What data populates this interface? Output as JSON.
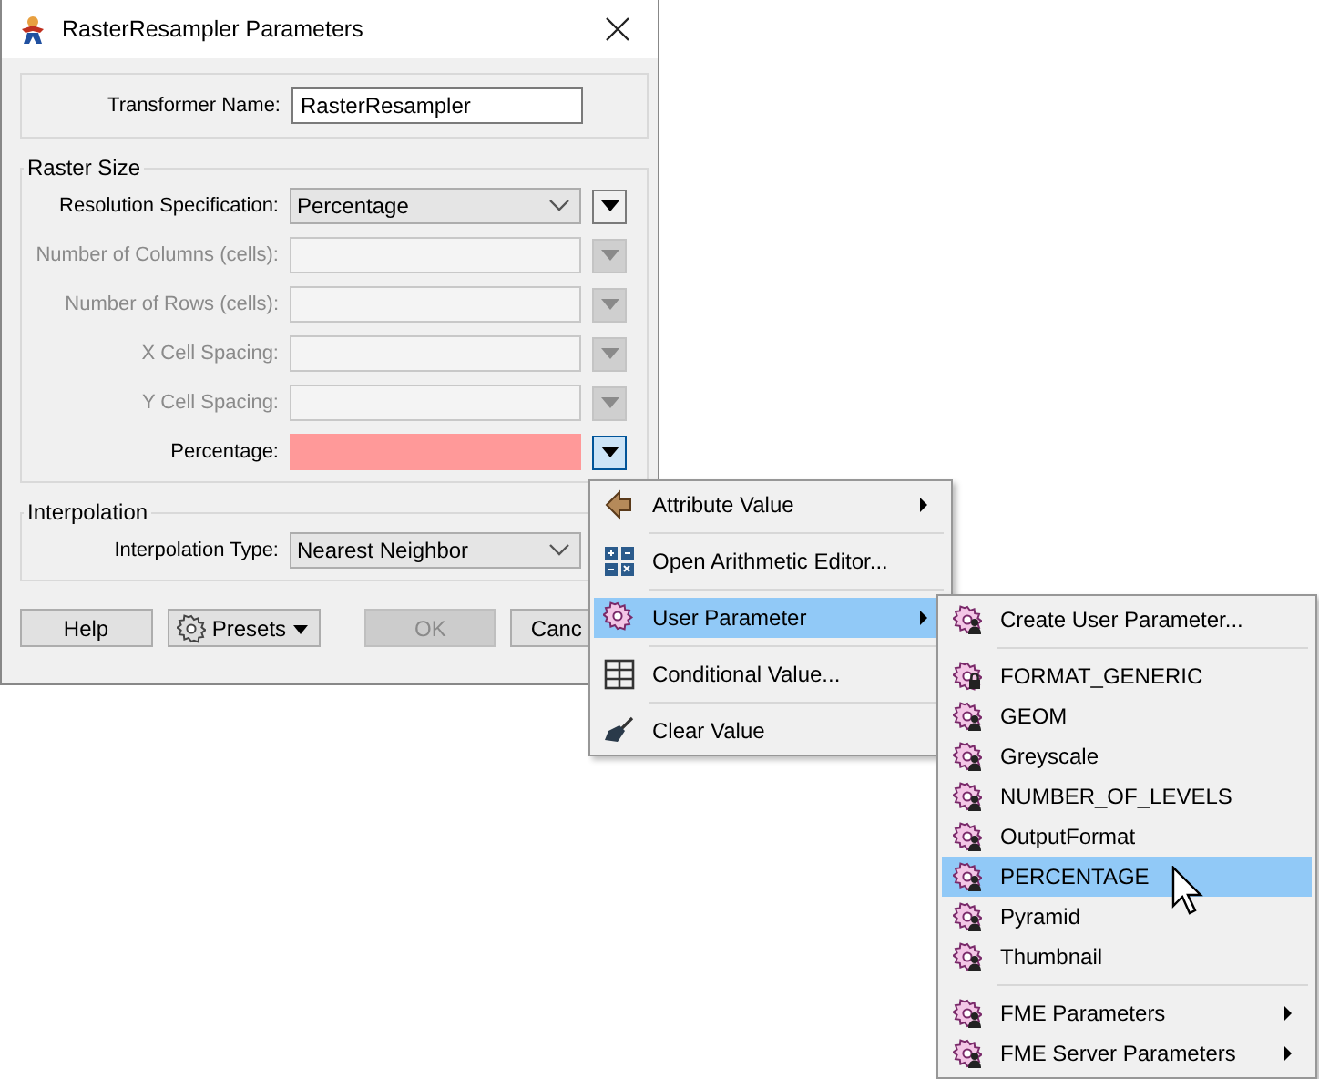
{
  "window": {
    "title": "RasterResampler Parameters"
  },
  "transformer_name": {
    "label": "Transformer Name:",
    "value": "RasterResampler"
  },
  "raster_size": {
    "title": "Raster Size",
    "rows": [
      {
        "label": "Resolution Specification:",
        "kind": "select",
        "value": "Percentage",
        "disabled": false,
        "menu_open": false
      },
      {
        "label": "Number of Columns (cells):",
        "kind": "text",
        "disabled": true,
        "invalid": false,
        "menu_open": false
      },
      {
        "label": "Number of Rows (cells):",
        "kind": "text",
        "disabled": true,
        "invalid": false,
        "menu_open": false
      },
      {
        "label": "X Cell Spacing:",
        "kind": "text",
        "disabled": true,
        "invalid": false,
        "menu_open": false
      },
      {
        "label": "Y Cell Spacing:",
        "kind": "text",
        "disabled": true,
        "invalid": false,
        "menu_open": false
      },
      {
        "label": "Percentage:",
        "kind": "text",
        "disabled": false,
        "invalid": true,
        "menu_open": true
      }
    ]
  },
  "interpolation": {
    "title": "Interpolation",
    "rows": [
      {
        "label": "Interpolation Type:",
        "kind": "select",
        "value": "Nearest Neighbor",
        "disabled": false
      }
    ]
  },
  "buttons": [
    {
      "label": "Help",
      "kind": "plain",
      "disabled": false
    },
    {
      "label": "Presets",
      "kind": "presets",
      "disabled": false
    },
    {
      "label": "OK",
      "kind": "plain",
      "disabled": true
    },
    {
      "label": "Canc",
      "kind": "plain",
      "disabled": false
    }
  ],
  "context_menu": {
    "items": [
      {
        "label": "Attribute Value",
        "has_submenu": true,
        "selected": false
      },
      {
        "label": "Open Arithmetic Editor...",
        "has_submenu": false,
        "selected": false
      },
      {
        "label": "User Parameter",
        "has_submenu": true,
        "selected": true
      },
      {
        "label": "Conditional Value...",
        "has_submenu": false,
        "selected": false
      },
      {
        "label": "Clear Value",
        "has_submenu": false,
        "selected": false
      }
    ]
  },
  "user_parameter_menu": {
    "sections": [
      [
        {
          "label": "Create User Parameter...",
          "has_submenu": false,
          "selected": false,
          "locked": false
        }
      ],
      [
        {
          "label": "FORMAT_GENERIC",
          "has_submenu": false,
          "selected": false,
          "locked": true
        },
        {
          "label": "GEOM",
          "has_submenu": false,
          "selected": false,
          "locked": false
        },
        {
          "label": "Greyscale",
          "has_submenu": false,
          "selected": false,
          "locked": false
        },
        {
          "label": "NUMBER_OF_LEVELS",
          "has_submenu": false,
          "selected": false,
          "locked": false
        },
        {
          "label": "OutputFormat",
          "has_submenu": false,
          "selected": false,
          "locked": false
        },
        {
          "label": "PERCENTAGE",
          "has_submenu": false,
          "selected": true,
          "locked": false
        },
        {
          "label": "Pyramid",
          "has_submenu": false,
          "selected": false,
          "locked": false
        },
        {
          "label": "Thumbnail",
          "has_submenu": false,
          "selected": false,
          "locked": false
        }
      ],
      [
        {
          "label": "FME Parameters",
          "has_submenu": true,
          "selected": false,
          "locked": false
        },
        {
          "label": "FME Server Parameters",
          "has_submenu": true,
          "selected": false,
          "locked": false
        }
      ]
    ]
  }
}
